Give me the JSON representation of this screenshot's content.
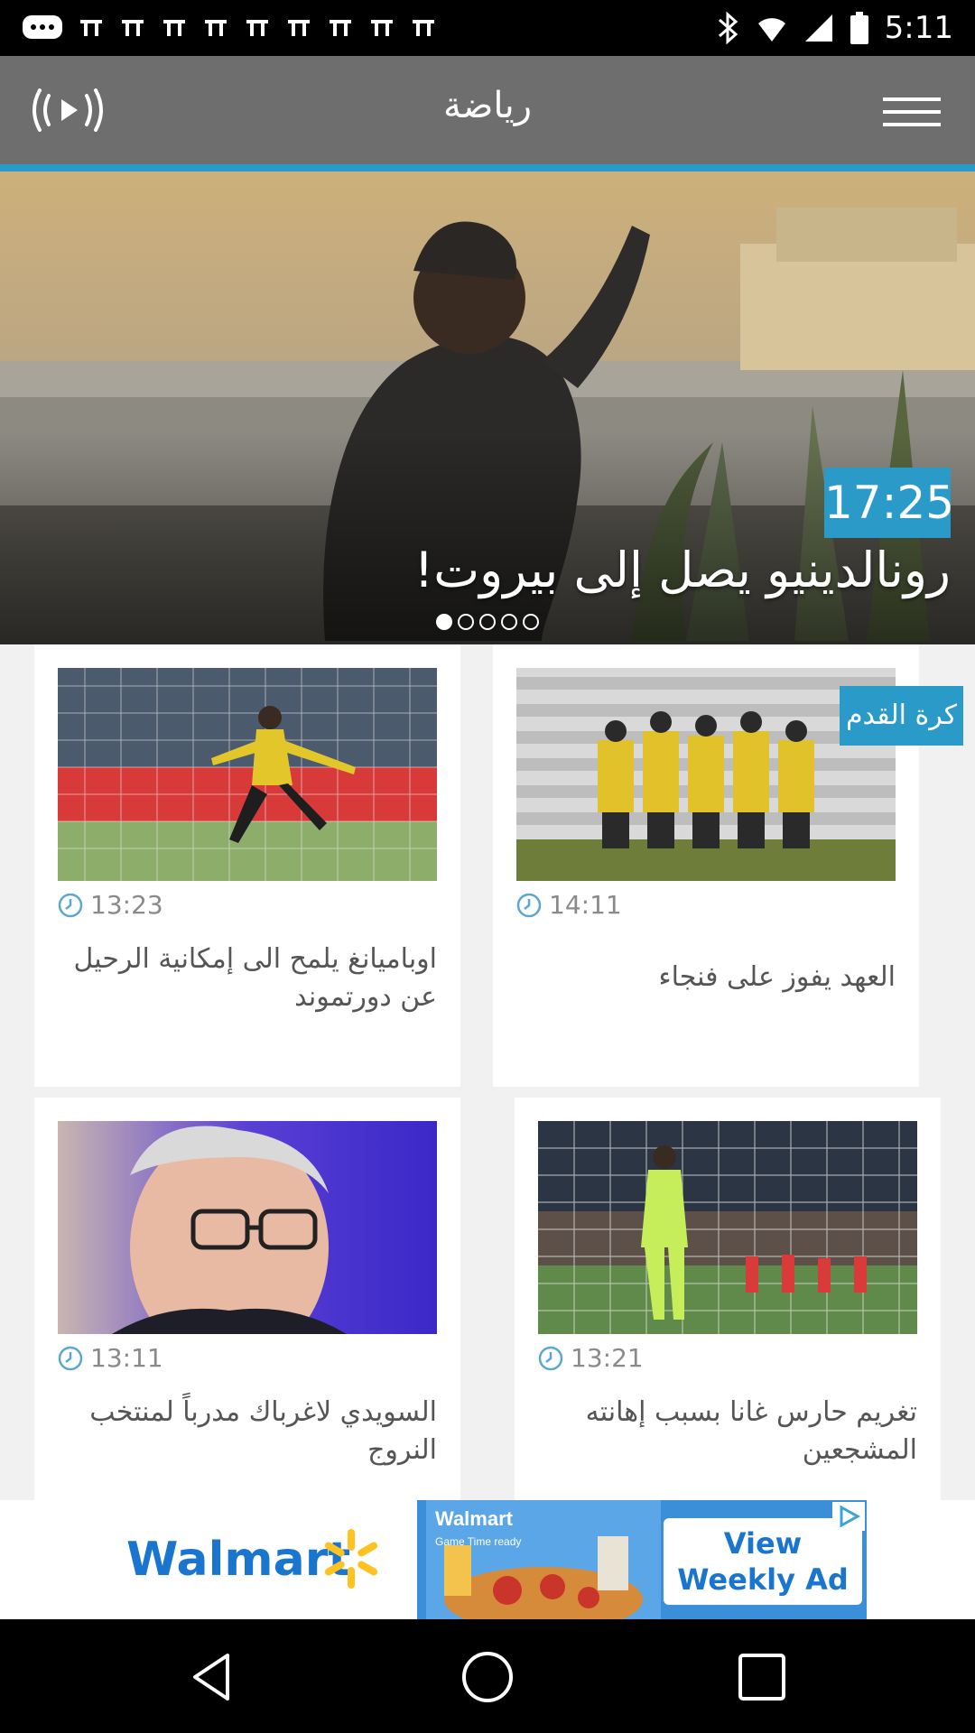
{
  "status_bar": {
    "time": "5:11"
  },
  "header": {
    "title": "رياضة",
    "radio_icon": "radio-play-icon",
    "menu_icon": "hamburger-menu-icon"
  },
  "hero": {
    "time": "17:25",
    "title": "رونالدينيو يصل إلى بيروت!",
    "dots_total": 5,
    "active_dot": 0
  },
  "category_badge": "كرة القدم",
  "cards": [
    {
      "time": "14:11",
      "headline": "العهد يفوز على فنجاء"
    },
    {
      "time": "13:23",
      "headline": "اوباميانغ يلمح الى إمكانية الرحيل عن دورتموند"
    },
    {
      "time": "13:21",
      "headline": "تغريم حارس غانا بسبب إهانته المشجعين"
    },
    {
      "time": "13:11",
      "headline": "السويدي لاغرباك مدرباً لمنتخب النروج"
    }
  ],
  "ad": {
    "brand": "Walmart",
    "panel_brand": "Walmart",
    "panel_small": "Game Time ready",
    "cta": "View Weekly Ad"
  },
  "colors": {
    "accent": "#2a9ac8",
    "header": "#6e6e6e",
    "walmart_blue": "#1a75cf",
    "walmart_yellow": "#ffc220"
  }
}
